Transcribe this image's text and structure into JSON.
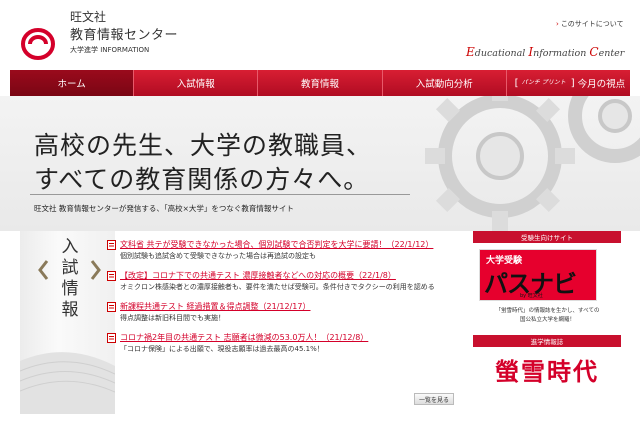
{
  "header": {
    "brand_line1": "旺文社",
    "brand_line2": "教育情報センター",
    "brand_line3": "大学進学 INFORMATION",
    "about_link": "このサイトについて",
    "tagline_parts": [
      "E",
      "ducational ",
      "I",
      "nformation ",
      "C",
      "enter"
    ]
  },
  "nav": {
    "items": [
      "ホーム",
      "入試情報",
      "教育情報",
      "入試動向分析",
      "今月の視点"
    ],
    "special_small": "パンチ\nプリント",
    "bracket_open": "[",
    "bracket_close": "]"
  },
  "hero": {
    "title_line1": "高校の先生、大学の教職員、",
    "title_line2": "すべての教育関係の方々へ。",
    "subtitle": "旺文社 教育情報センターが発信する、「高校×大学」をつなぐ教育情報サイト"
  },
  "news": {
    "heading": "入試情報",
    "items": [
      {
        "title": "文科省 共テが受験できなかった場合、個別試験で合否判定を大学に要請！（22/1/12）",
        "desc": "個別試験も追試含めて受験できなかった場合は再追試の設定も"
      },
      {
        "title": "【改定】コロナ下での共通テスト 濃厚接触者などへの対応の概要（22/1/8）",
        "desc": "オミクロン株感染者との濃厚接触者も、要件を満たせば受験可。条件付きでタクシーの利用を認める"
      },
      {
        "title": "新課程共通テスト 経過措置＆得点調整（21/12/17）",
        "desc": "得点調整は新旧科目間でも実施！"
      },
      {
        "title": "コロナ禍2年目の共通テスト 志願者は微減の53.0万人！（21/12/8）",
        "desc": "「コロナ保険」による出願で、現役志願率は過去最高の45.1%！"
      }
    ],
    "list_button": "一覧を見る"
  },
  "side": {
    "section1": "受験生向けサイト",
    "pasnavi_top": "大学受験",
    "pasnavi_main": "パスナビ",
    "pasnavi_by": "by 旺文社",
    "pasnavi_desc1": "「蛍雪時代」の情報誌を生かし、すべての",
    "pasnavi_desc2": "国公私立大学を網羅！",
    "section2": "進学情報誌",
    "keisetsu": "螢雪時代"
  },
  "colors": {
    "brand_red": "#c8102e",
    "link_red": "#d4002a"
  }
}
